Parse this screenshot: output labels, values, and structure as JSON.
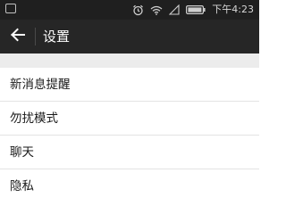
{
  "status_bar": {
    "time": "下午4:23",
    "icons": [
      "notification-box-icon",
      "alarm-clock-icon",
      "wifi-icon",
      "signal-icon",
      "battery-icon"
    ]
  },
  "app_bar": {
    "title": "设置",
    "back_icon": "arrow-left-icon"
  },
  "settings": {
    "items": [
      {
        "label": "新消息提醒"
      },
      {
        "label": "勿扰模式"
      },
      {
        "label": "聊天"
      },
      {
        "label": "隐私"
      }
    ]
  },
  "colors": {
    "status_bar_bg": "#1f1f1f",
    "app_bar_bg": "#262626",
    "gap_bg": "#ececec",
    "list_bg": "#ffffff",
    "divider": "#e3e3e3"
  }
}
